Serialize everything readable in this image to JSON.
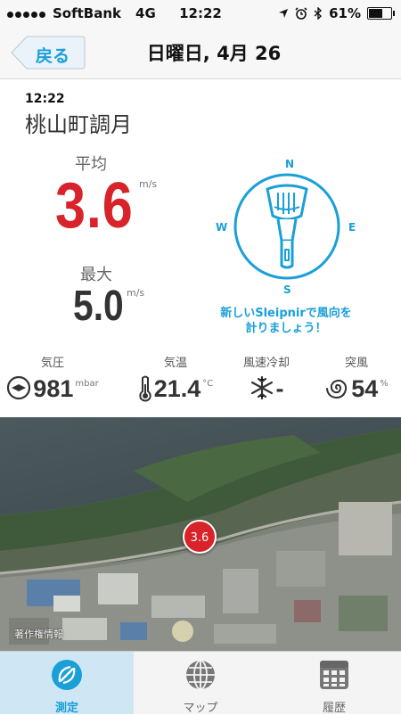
{
  "status": {
    "carrier": "SoftBank",
    "network": "4G",
    "time": "12:22",
    "battery": "61%",
    "battery_level": 0.61
  },
  "nav": {
    "back_label": "戻る",
    "title": "日曜日, 4月 26"
  },
  "reading": {
    "time": "12:22",
    "place": "桃山町調月"
  },
  "average": {
    "label": "平均",
    "value": "3.6",
    "unit": "m/s"
  },
  "max": {
    "label": "最大",
    "value": "5.0",
    "unit": "m/s"
  },
  "compass": {
    "n": "N",
    "e": "E",
    "s": "S",
    "w": "W",
    "message_line1": "新しいSleipnirで風向を",
    "message_line2": "計りましょう！"
  },
  "metrics": [
    {
      "label": "気圧",
      "value": "981",
      "unit": "mbar",
      "icon": "barometer-icon"
    },
    {
      "label": "気温",
      "value": "21.4",
      "unit": "°C",
      "icon": "thermometer-icon"
    },
    {
      "label": "風速冷却",
      "value": "-",
      "unit": "",
      "icon": "snowflake-icon"
    },
    {
      "label": "突風",
      "value": "54",
      "unit": "%",
      "icon": "gust-spiral-icon"
    }
  ],
  "map": {
    "marker_value": "3.6",
    "copyright": "著作権情報"
  },
  "tabs": [
    {
      "label": "測定",
      "icon": "measure-icon",
      "active": true
    },
    {
      "label": "マップ",
      "icon": "globe-icon",
      "active": false
    },
    {
      "label": "履歴",
      "icon": "calendar-grid-icon",
      "active": false
    }
  ],
  "colors": {
    "accent": "#1a9fd8",
    "wind_red": "#d8232a"
  }
}
